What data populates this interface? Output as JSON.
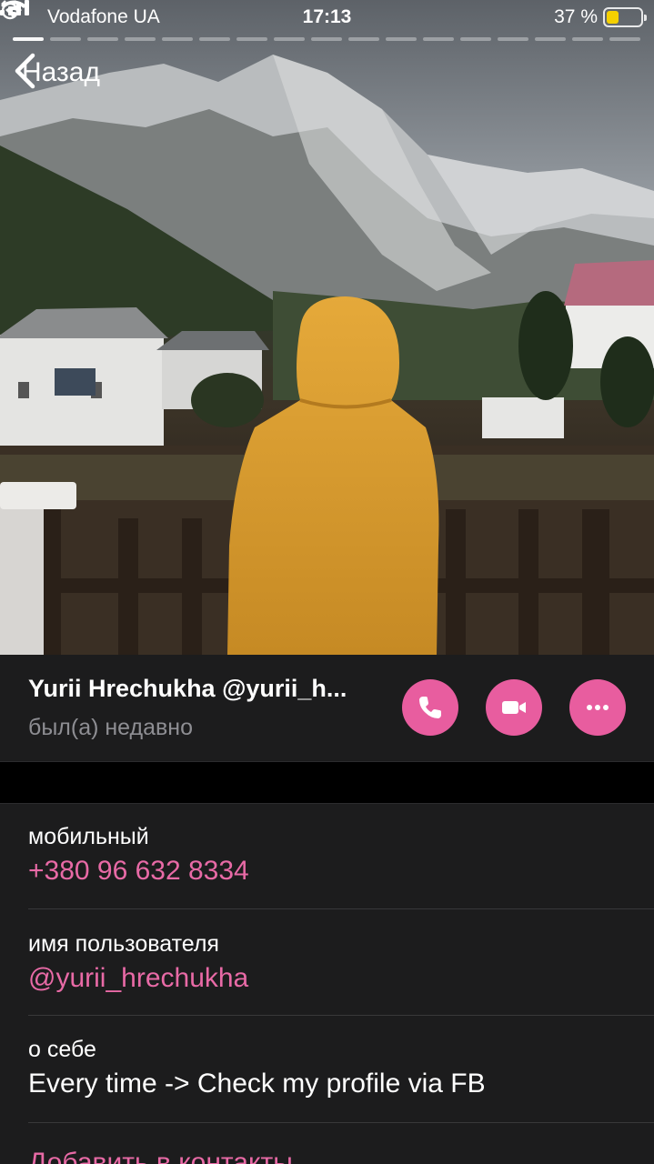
{
  "status_bar": {
    "carrier": "Vodafone UA",
    "time": "17:13",
    "battery_percent": "37 %",
    "battery_level": 0.37,
    "icons": [
      "signal-icon",
      "wifi-icon",
      "alarm-icon",
      "battery-icon"
    ]
  },
  "story": {
    "segments_total": 17,
    "active_segment": 1
  },
  "nav": {
    "back_label": "Назад",
    "icon": "chevron-left-icon"
  },
  "profile": {
    "name": "Yurii Hrechukha @yurii_h...",
    "status": "был(а) недавно",
    "actions": [
      {
        "name": "call",
        "icon": "phone-icon"
      },
      {
        "name": "video",
        "icon": "video-camera-icon"
      },
      {
        "name": "more",
        "icon": "more-dots-icon"
      }
    ]
  },
  "info": {
    "mobile_label": "мобильный",
    "mobile_value": "+380 96 632 8334",
    "username_label": "имя пользователя",
    "username_value": "@yurii_hrechukha",
    "bio_label": "о себе",
    "bio_value": "Every time -> Check my profile via FB",
    "add_contact": "Добавить в контакты"
  },
  "colors": {
    "accent": "#e85d9f",
    "background": "#1c1c1d",
    "secondary_text": "#8e8e93",
    "battery": "#f5d000"
  }
}
